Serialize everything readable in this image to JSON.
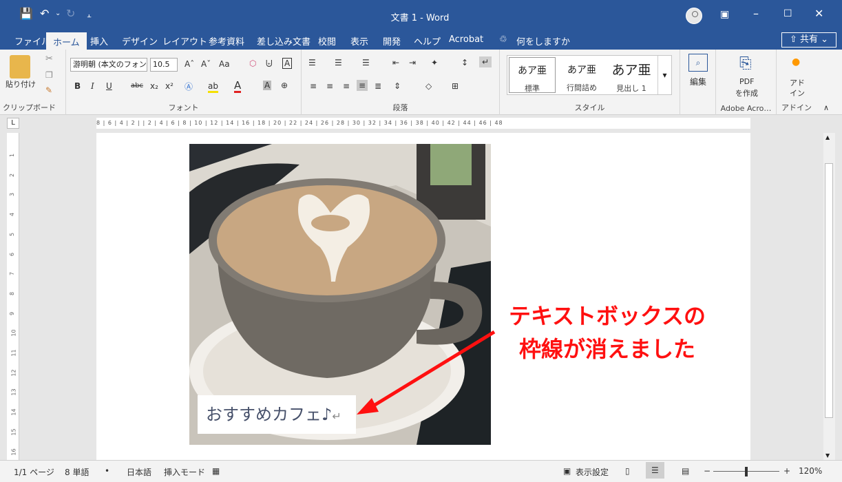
{
  "window": {
    "title": "文書 1 - Word",
    "share_label": "共有",
    "share_caret": "⌄"
  },
  "quick_access": {
    "save_icon": "save-icon",
    "undo_icon": "undo-icon",
    "redo_icon": "redo-icon"
  },
  "tabs": [
    {
      "label": "ファイル"
    },
    {
      "label": "ホーム"
    },
    {
      "label": "挿入"
    },
    {
      "label": "デザイン"
    },
    {
      "label": "レイアウト"
    },
    {
      "label": "参考資料"
    },
    {
      "label": "差し込み文書"
    },
    {
      "label": "校閲"
    },
    {
      "label": "表示"
    },
    {
      "label": "開発"
    },
    {
      "label": "ヘルプ"
    },
    {
      "label": "Acrobat"
    }
  ],
  "tell_me": "何をしますか",
  "ribbon": {
    "clipboard": {
      "paste_label": "貼り付け",
      "group_label": "クリップボード"
    },
    "font": {
      "font_name": "游明朝 (本文のフォント)",
      "font_size": "10.5",
      "group_label": "フォント",
      "aa_label": "Aa"
    },
    "paragraph": {
      "group_label": "段落"
    },
    "styles": {
      "group_label": "スタイル",
      "items": [
        {
          "preview": "あア亜",
          "label": "標準"
        },
        {
          "preview": "あア亜",
          "label": "行間詰め"
        },
        {
          "preview": "あア亜",
          "label": "見出し 1"
        }
      ]
    },
    "editing": {
      "label": "編集",
      "group_label": ""
    },
    "adobe": {
      "label_line1": "PDF",
      "label_line2": "を作成",
      "group_label": "Adobe Acro…"
    },
    "addin": {
      "label_line1": "アド",
      "label_line2": "イン",
      "group_label": "アドイン"
    }
  },
  "ruler": {
    "h_marks": "8  | 6 |  4 |  2 |   | 2 |  4 |  6 |  8 | 10 | 12 | 14 | 16 | 18 | 20 | 22 | 24 | 26 | 28 | 30 | 32 | 34 | 36 | 38 | 40 | 42 | 44 | 46 | 48",
    "v_marks": [
      "1",
      "2",
      "3",
      "4",
      "5",
      "6",
      "7",
      "8",
      "9",
      "10",
      "11",
      "12",
      "13",
      "14",
      "15",
      "16"
    ]
  },
  "document": {
    "textbox_text": "おすすめカフェ♪",
    "paragraph_mark": "↵",
    "callout_line1": "テキストボックスの",
    "callout_line2": "枠線が消えました"
  },
  "status_bar": {
    "page": "1/1 ページ",
    "words": "8 単語",
    "language": "日本語",
    "mode": "挿入モード",
    "display_settings": "表示設定",
    "zoom": "120%",
    "zoom_minus": "−",
    "zoom_plus": "+"
  },
  "colors": {
    "title_bar": "#2b579a",
    "callout": "#ff1010",
    "textbox_text": "#46506a"
  }
}
